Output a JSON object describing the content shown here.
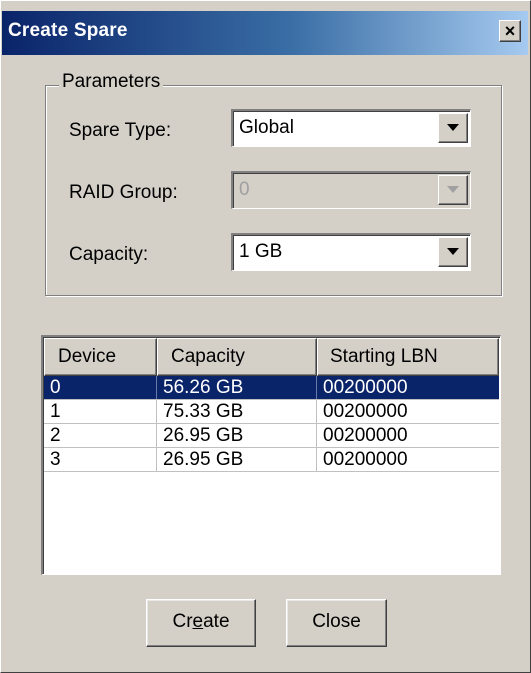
{
  "window": {
    "title": "Create Spare",
    "close_label": "×"
  },
  "parameters": {
    "legend": "Parameters",
    "spare_type": {
      "label": "Spare Type:",
      "value": "Global",
      "enabled": true
    },
    "raid_group": {
      "label": "RAID Group:",
      "value": "0",
      "enabled": false
    },
    "capacity": {
      "label": "Capacity:",
      "value": "1 GB",
      "enabled": true
    }
  },
  "table": {
    "columns": [
      "Device",
      "Capacity",
      "Starting LBN"
    ],
    "rows": [
      {
        "device": "0",
        "capacity": "56.26 GB",
        "lbn": "00200000",
        "selected": true
      },
      {
        "device": "1",
        "capacity": "75.33 GB",
        "lbn": "00200000",
        "selected": false
      },
      {
        "device": "2",
        "capacity": "26.95 GB",
        "lbn": "00200000",
        "selected": false
      },
      {
        "device": "3",
        "capacity": "26.95 GB",
        "lbn": "00200000",
        "selected": false
      }
    ]
  },
  "buttons": {
    "create": {
      "pre": "Cr",
      "mnemonic": "e",
      "post": "ate"
    },
    "close": "Close"
  },
  "colors": {
    "selection": "#0a246a",
    "face": "#d4d0c8",
    "title_start": "#0a246a"
  }
}
